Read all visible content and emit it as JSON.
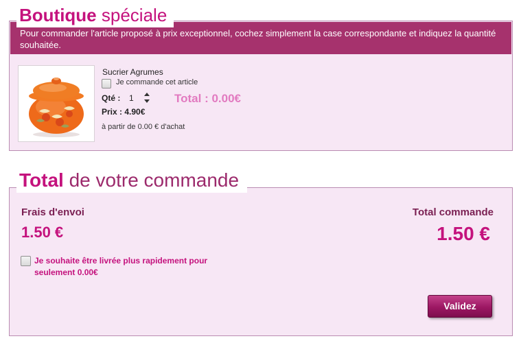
{
  "special_shop": {
    "title_strong": "Boutique",
    "title_light": "spéciale",
    "intro": "Pour commander l'article proposé à prix exceptionnel, cochez simplement la case correspondante et indiquez la quantité souhaitée.",
    "product": {
      "image_icon": "sugar-bowl-image",
      "name": "Sucrier Agrumes",
      "order_checkbox_label": "Je commande cet article",
      "order_checked": false,
      "qty_label": "Qté :",
      "qty_value": "1",
      "total_label": "Total : 0.00€",
      "price_label": "Prix : 4.90€",
      "threshold_text": "à partir de 0.00 € d'achat"
    }
  },
  "order_total": {
    "title_strong": "Total",
    "title_light": "de votre commande",
    "shipping_label": "Frais d'envoi",
    "shipping_value": "1.50 €",
    "total_label": "Total commande",
    "total_value": "1.50 €",
    "express_label": "Je souhaite être livrée plus rapidement pour seulement 0.00€",
    "express_checked": false,
    "validate_label": "Validez"
  },
  "colors": {
    "accent": "#c4127d",
    "banner": "#a6326d",
    "panel_bg": "#f7e7f5",
    "panel_border": "#b98bb1",
    "total_pink": "#e27ac0"
  }
}
